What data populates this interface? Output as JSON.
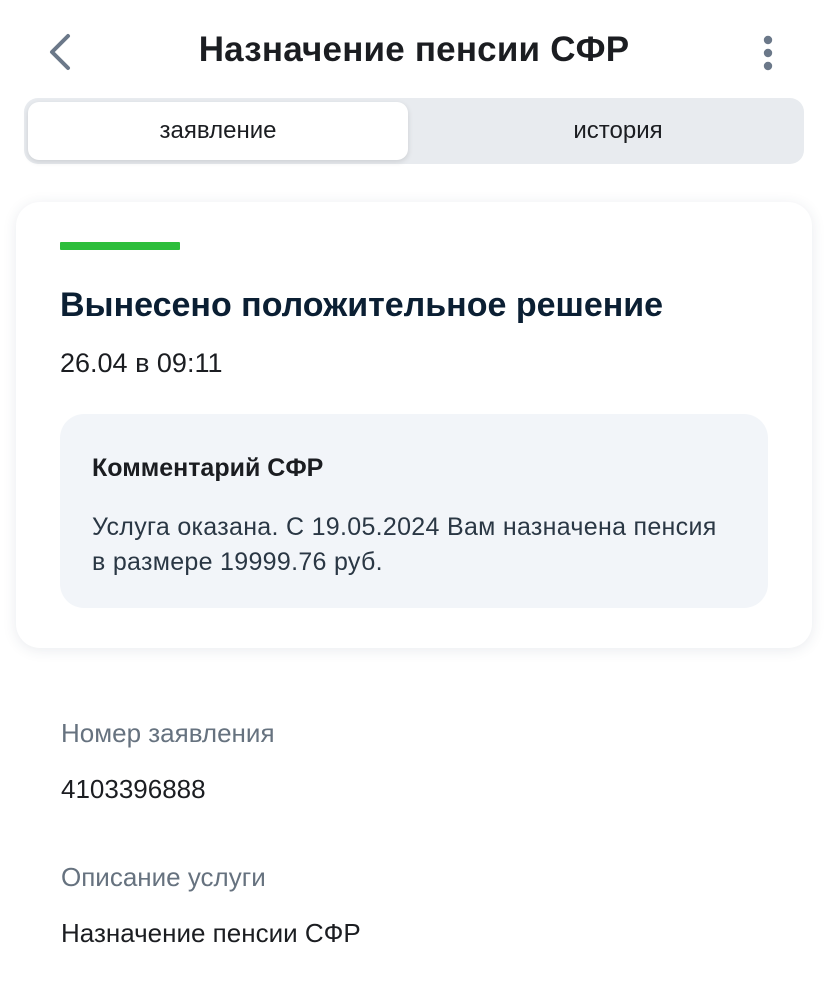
{
  "header": {
    "title": "Назначение пенсии СФР",
    "back_icon": "chevron-left-icon",
    "menu_icon": "more-vertical-icon"
  },
  "tabs": [
    {
      "label": "заявление",
      "active": true
    },
    {
      "label": "история",
      "active": false
    }
  ],
  "status_card": {
    "status_color": "#2dbe3b",
    "title": "Вынесено положительное решение",
    "datetime": "26.04 в 09:11",
    "comment": {
      "title": "Комментарий СФР",
      "text": "Услуга оказана. С 19.05.2024 Вам назначена пенсия в размере 19999.76 руб."
    }
  },
  "details": [
    {
      "label": "Номер заявления",
      "value": "4103396888"
    },
    {
      "label": "Описание услуги",
      "value": "Назначение пенсии СФР"
    }
  ]
}
